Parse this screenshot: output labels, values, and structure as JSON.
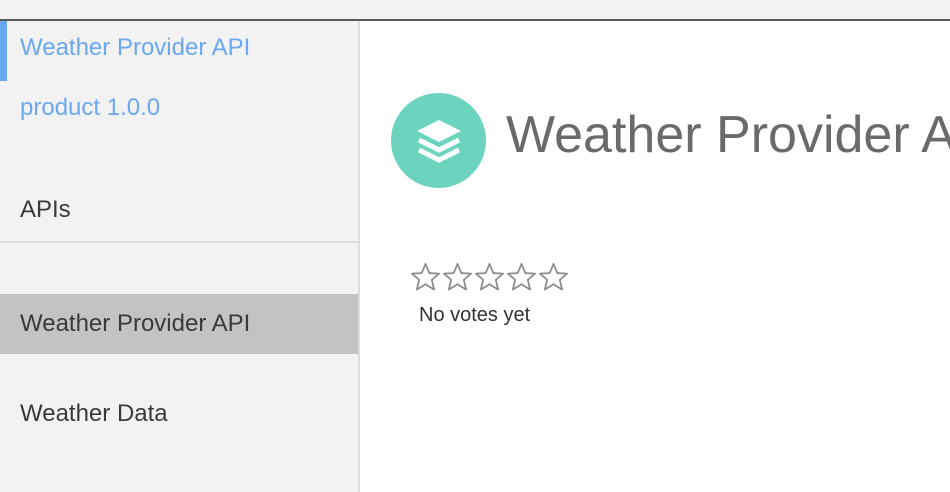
{
  "sidebar": {
    "product": {
      "title": "Weather Provider API",
      "version": "product 1.0.0"
    },
    "apis_heading": "APIs",
    "items": [
      {
        "label": "Weather Provider API",
        "active": true
      },
      {
        "label": "Weather Data",
        "active": false
      }
    ]
  },
  "main": {
    "title": "Weather Provider API",
    "icon": "layers-icon",
    "rating": {
      "stars_filled": 0,
      "stars_total": 5,
      "status_text": "No votes yet"
    }
  },
  "colors": {
    "accent": "#6aa8f0",
    "badge": "#6cd3bf",
    "active_nav": "#c3c3c3"
  }
}
